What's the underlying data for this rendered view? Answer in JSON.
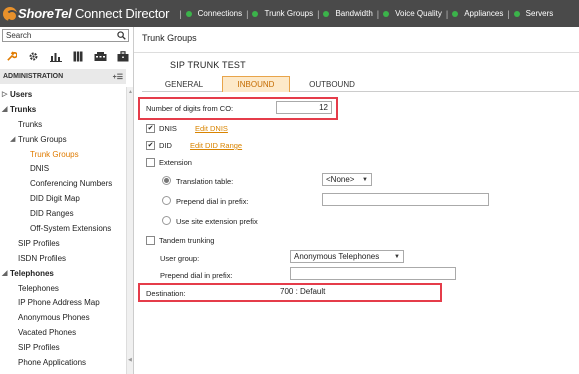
{
  "app": {
    "logo_brand": "ShoreTel",
    "logo_product": "Connect Director"
  },
  "topnav": [
    {
      "label": "Connections"
    },
    {
      "label": "Trunk Groups"
    },
    {
      "label": "Bandwidth"
    },
    {
      "label": "Voice Quality"
    },
    {
      "label": "Appliances"
    },
    {
      "label": "Servers"
    }
  ],
  "sidebar": {
    "search_value": "Search",
    "section_title": "ADMINISTRATION",
    "items": [
      {
        "label": "Users"
      },
      {
        "label": "Trunks"
      },
      {
        "label": "Trunks"
      },
      {
        "label": "Trunk Groups"
      },
      {
        "label": "Trunk Groups"
      },
      {
        "label": "DNIS"
      },
      {
        "label": "Conferencing Numbers"
      },
      {
        "label": "DID Digit Map"
      },
      {
        "label": "DID Ranges"
      },
      {
        "label": "Off-System Extensions"
      },
      {
        "label": "SIP Profiles"
      },
      {
        "label": "ISDN Profiles"
      },
      {
        "label": "Telephones"
      },
      {
        "label": "Telephones"
      },
      {
        "label": "IP Phone Address Map"
      },
      {
        "label": "Anonymous Phones"
      },
      {
        "label": "Vacated Phones"
      },
      {
        "label": "SIP Profiles"
      },
      {
        "label": "Phone Applications"
      }
    ]
  },
  "main": {
    "title": "Trunk Groups",
    "trunk_name": "SIP TRUNK TEST",
    "tabs": [
      {
        "label": "GENERAL"
      },
      {
        "label": "INBOUND"
      },
      {
        "label": "OUTBOUND"
      }
    ],
    "digits_label": "Number of digits from CO:",
    "digits_value": "12",
    "dnis_label": "DNIS",
    "edit_dnis": "Edit DNIS",
    "did_label": "DID",
    "edit_did": "Edit DID Range",
    "extension_label": "Extension",
    "translation_label": "Translation table:",
    "translation_value": "<None>",
    "prepend_label": "Prepend dial in prefix:",
    "use_site_label": "Use site extension prefix",
    "tandem_label": "Tandem trunking",
    "user_group_label": "User group:",
    "user_group_value": "Anonymous Telephones",
    "prepend2_label": "Prepend dial in prefix:",
    "destination_label": "Destination:",
    "destination_value": "700 : Default"
  },
  "colors": {
    "accent": "#e07b00",
    "highlight": "#e53c4a",
    "nav_dot": "#3bb34a",
    "topbar": "#4a4a4a"
  }
}
